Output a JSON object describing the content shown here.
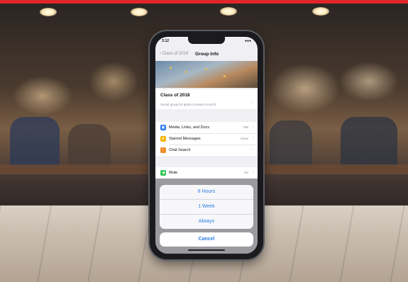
{
  "status_bar": {
    "time": "3:12",
    "indicators": "●●●"
  },
  "nav": {
    "back_label": "‹ Class of 2018",
    "title": "Group Info"
  },
  "group": {
    "name": "Class of 2018",
    "description": "Social group for grads to keep in touch!"
  },
  "rows": [
    {
      "icon": "photo-icon",
      "color": "#2d7cf6",
      "label": "Media, Links, and Docs",
      "value": "768"
    },
    {
      "icon": "star-icon",
      "color": "#f4b400",
      "label": "Starred Messages",
      "value": "None"
    },
    {
      "icon": "search-icon",
      "color": "#f08a24",
      "label": "Chat Search",
      "value": ""
    },
    {
      "icon": "speaker-icon",
      "color": "#34c759",
      "label": "Mute",
      "value": "No"
    }
  ],
  "sheet": {
    "options": [
      "8 Hours",
      "1 Week",
      "Always"
    ],
    "cancel_label": "Cancel"
  },
  "colors": {
    "accent": "#2a7de1",
    "brand_bar": "#e0262a"
  }
}
